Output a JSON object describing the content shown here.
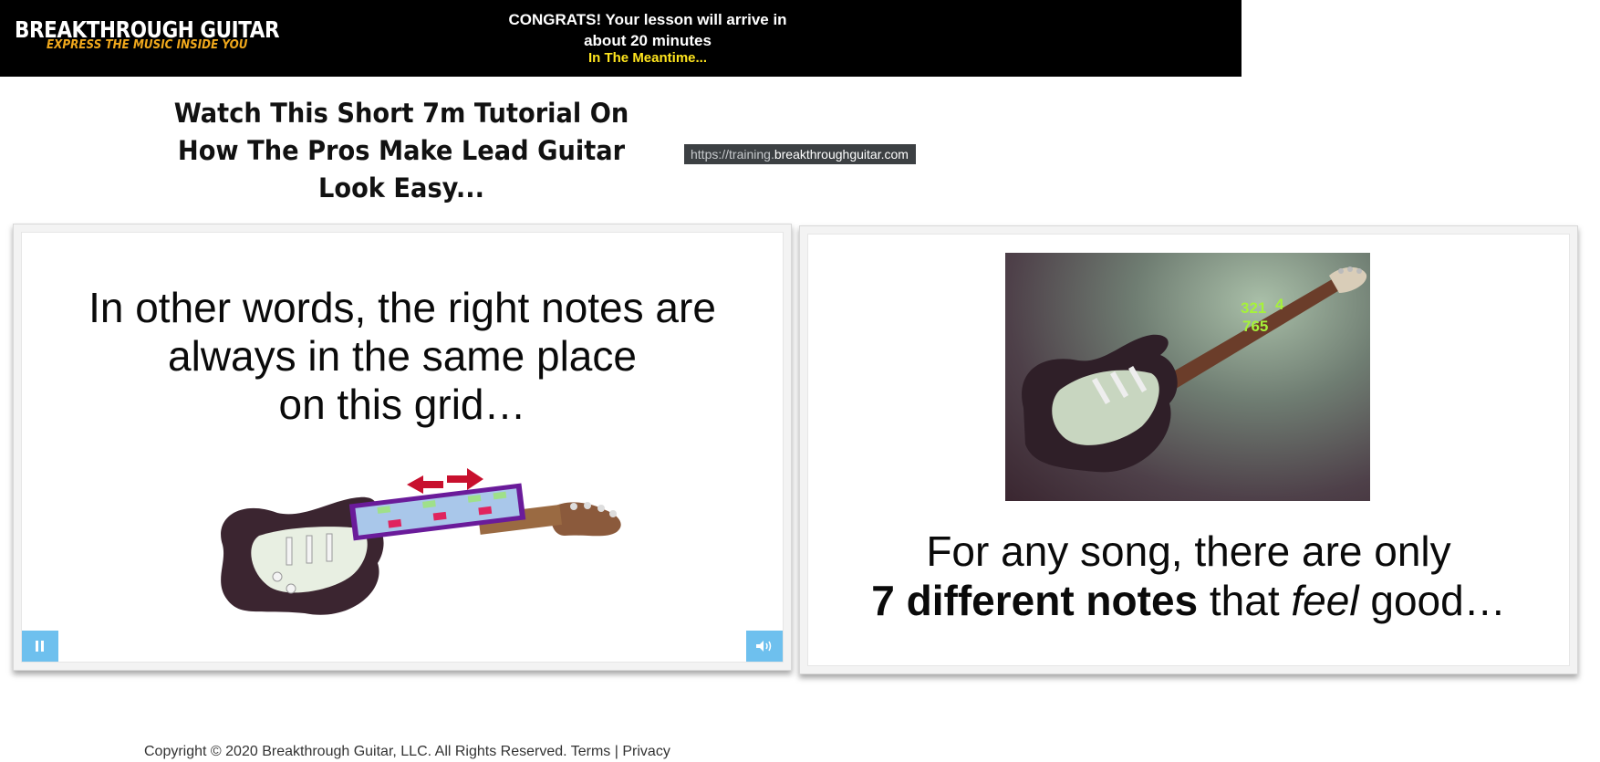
{
  "header": {
    "logo_main": "BREAKTHROUGH GUITAR",
    "logo_tagline": "EXPRESS THE MUSIC INSIDE YOU",
    "congrats_line1": "CONGRATS! Your lesson will arrive in",
    "congrats_line2": "about 20 minutes",
    "meantime": "In The Meantime..."
  },
  "main": {
    "heading_line1": "Watch This Short 7m Tutorial On",
    "heading_line2": "How The Pros Make Lead Guitar",
    "heading_line3": "Look Easy...",
    "url_tooltip_proto": "https://training.",
    "url_tooltip_domain": "breakthroughguitar.com"
  },
  "video_left": {
    "line1": "In other words, the right notes are",
    "line2": "always in the same place",
    "line3": "on this grid…",
    "pause_icon": "pause-icon",
    "volume_icon": "volume-icon"
  },
  "video_right": {
    "line1": "For any song, there are only",
    "line2_bold": "7 different notes",
    "line2_mid": " that ",
    "line2_italic": "feel",
    "line2_end": " good…",
    "fret_numbers_top": "321",
    "fret_numbers_4": "4",
    "fret_numbers_bottom": "765"
  },
  "footer": {
    "copyright": "Copyright © 2020 Breakthrough Guitar, LLC. All Rights Reserved. ",
    "terms": "Terms",
    "separator": " | ",
    "privacy": "Privacy"
  },
  "colors": {
    "header_bg": "#000000",
    "tagline": "#f0a81c",
    "meantime": "#ffe51e",
    "control_bg": "#6ec0ee",
    "arrow_red": "#c8102e"
  }
}
